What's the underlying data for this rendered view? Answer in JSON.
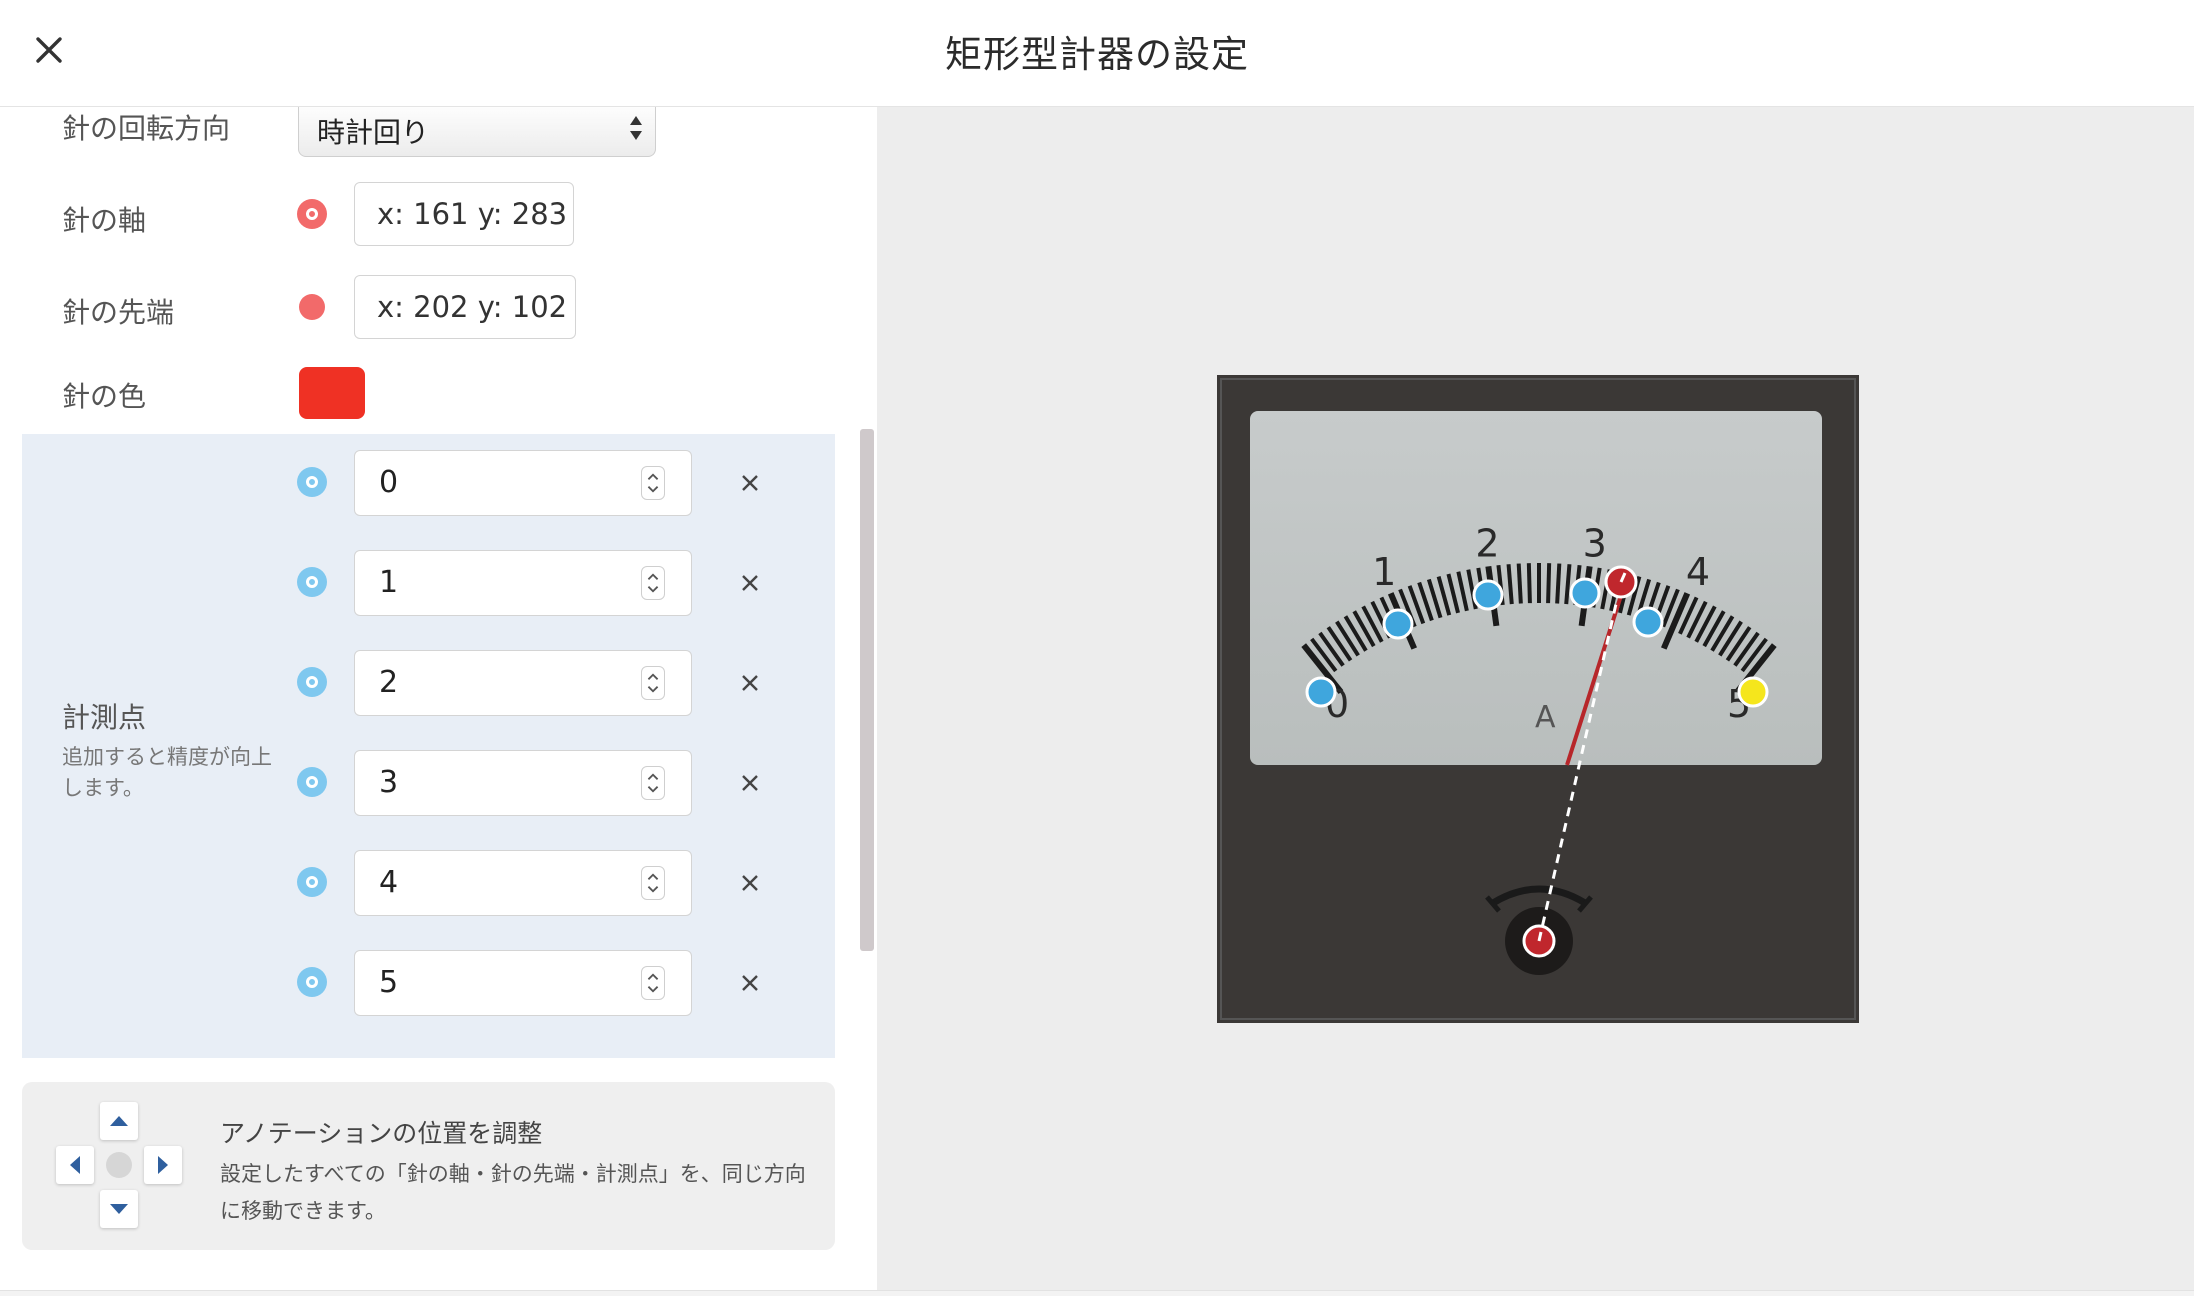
{
  "header": {
    "title": "矩形型計器の設定",
    "close_icon": "close-icon"
  },
  "settings": {
    "rotation": {
      "label": "針の回転方向",
      "value": "時計回り"
    },
    "axis": {
      "label": "針の軸",
      "value": "x: 161 y: 283"
    },
    "tip": {
      "label": "針の先端",
      "value": "x: 202 y: 102"
    },
    "color": {
      "label": "針の色",
      "value": "#ef3124"
    }
  },
  "measurement_points": {
    "title": "計測点",
    "hint": "追加すると精度が向上します。",
    "items": [
      {
        "value": "0"
      },
      {
        "value": "1"
      },
      {
        "value": "2"
      },
      {
        "value": "3"
      },
      {
        "value": "4"
      },
      {
        "value": "5"
      }
    ]
  },
  "adjust": {
    "title": "アノテーションの位置を調整",
    "description": "設定したすべての「針の軸・針の先端・計測点」を、同じ方向に移動できます。"
  },
  "meter": {
    "scale_labels": [
      "0",
      "1",
      "2",
      "3",
      "4",
      "5"
    ],
    "unit": "A"
  },
  "colors": {
    "axis_marker": "#f26a6a",
    "point_marker": "#7fc8ef",
    "selected_point": "#f5e61c",
    "needle": "#ef3124",
    "panel_bg": "#e8eef6"
  }
}
